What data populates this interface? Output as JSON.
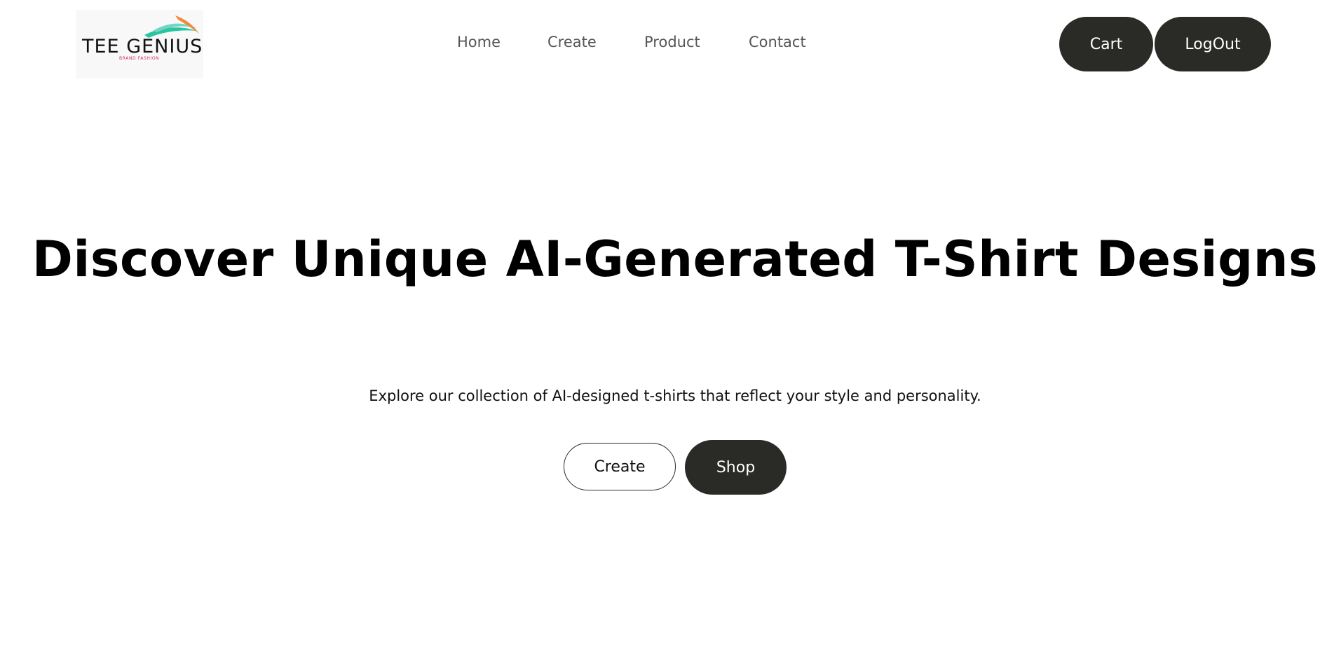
{
  "header": {
    "logo": {
      "brand": "TEE GENIUS",
      "tagline": "BRAND FASHION",
      "colors": {
        "swoosh_green": "#2bc4a0",
        "swoosh_orange": "#f08a3c",
        "tagline": "#d0306a",
        "wordmark": "#111111"
      }
    },
    "nav": {
      "items": [
        {
          "label": "Home"
        },
        {
          "label": "Create"
        },
        {
          "label": "Product"
        },
        {
          "label": "Contact"
        }
      ]
    },
    "actions": {
      "cart_label": "Cart",
      "logout_label": "LogOut"
    }
  },
  "hero": {
    "title": "Discover Unique AI-Generated T-Shirt Designs",
    "subtitle": "Explore our collection of AI-designed t-shirts that reflect your style and personality.",
    "create_label": "Create",
    "shop_label": "Shop"
  },
  "colors": {
    "button_dark": "#2a2b27",
    "nav_text": "#555555",
    "background": "#ffffff"
  }
}
